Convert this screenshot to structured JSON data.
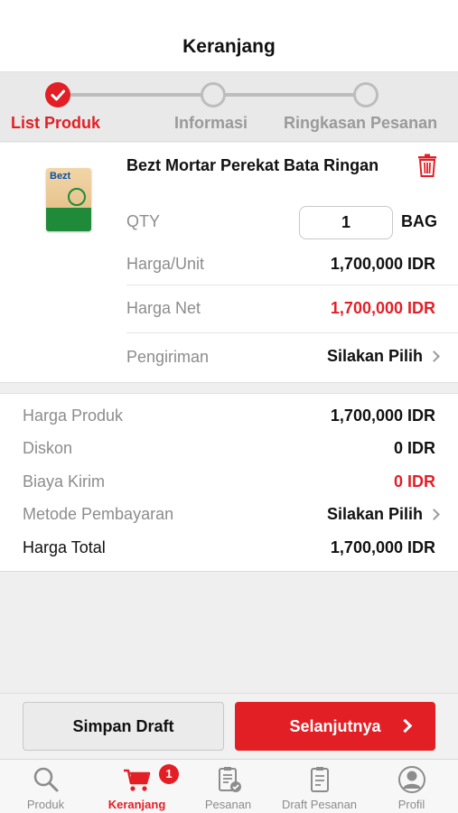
{
  "header": {
    "title": "Keranjang"
  },
  "stepper": {
    "steps": [
      {
        "label": "List Produk",
        "state": "done"
      },
      {
        "label": "Informasi",
        "state": "todo"
      },
      {
        "label": "Ringkasan Pesanan",
        "state": "todo"
      }
    ]
  },
  "product": {
    "name": "Bezt Mortar Perekat Bata Ringan",
    "image_logo": "Bezt",
    "qty_label": "QTY",
    "qty_value": "1",
    "unit": "BAG",
    "unit_price_label": "Harga/Unit",
    "unit_price_value": "1,700,000 IDR",
    "net_price_label": "Harga Net",
    "net_price_value": "1,700,000 IDR",
    "shipping_label": "Pengiriman",
    "shipping_value": "Silakan Pilih"
  },
  "summary": {
    "product_price_label": "Harga Produk",
    "product_price_value": "1,700,000 IDR",
    "discount_label": "Diskon",
    "discount_value": "0 IDR",
    "shipping_cost_label": "Biaya Kirim",
    "shipping_cost_value": "0 IDR",
    "payment_method_label": "Metode Pembayaran",
    "payment_method_value": "Silakan Pilih",
    "total_label": "Harga Total",
    "total_value": "1,700,000 IDR"
  },
  "actions": {
    "save_draft_label": "Simpan Draft",
    "next_label": "Selanjutnya"
  },
  "tabbar": {
    "cart_badge": "1",
    "tabs": [
      {
        "label": "Produk",
        "icon": "search-icon"
      },
      {
        "label": "Keranjang",
        "icon": "cart-icon"
      },
      {
        "label": "Pesanan",
        "icon": "clipboard-check-icon"
      },
      {
        "label": "Draft Pesanan",
        "icon": "clipboard-icon"
      },
      {
        "label": "Profil",
        "icon": "user-icon"
      }
    ]
  },
  "colors": {
    "accent": "#e31f26",
    "muted": "#8c8c8c"
  }
}
